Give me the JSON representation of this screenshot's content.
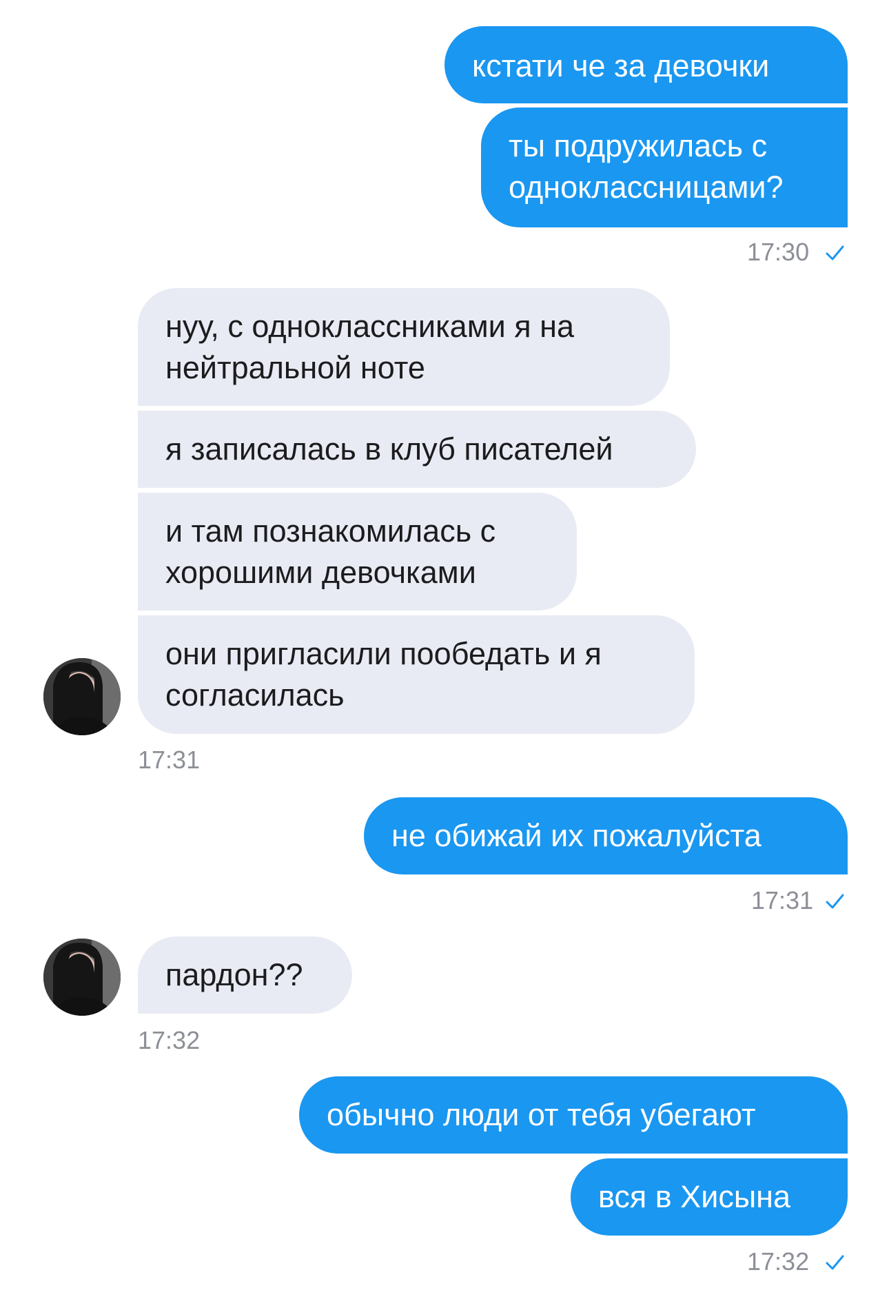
{
  "colors": {
    "outgoing_bubble": "#1a97f0",
    "incoming_bubble": "#e9ebf4",
    "read_check": "#1a97f0"
  },
  "messages": {
    "m1": "кстати че за девочки",
    "m2": "ты подружилась с\nодноклассницами?",
    "t1": "17:30",
    "m3": "нуу, с одноклассниками я на\nнейтральной ноте",
    "m4": "я записалась в клуб писателей",
    "m5": "и там познакомилась с\nхорошими девочками",
    "m6": "они пригласили пообедать и я\nсогласилась",
    "t2": "17:31",
    "m7": "не обижай их пожалуйста",
    "t3": "17:31",
    "m8": "пардон??",
    "t4": "17:32",
    "m9": "обычно люди от тебя убегают",
    "m10": "вся в Хисына",
    "t5": "17:32"
  },
  "icons": {
    "read_receipt": "check-icon",
    "avatar": "avatar"
  }
}
